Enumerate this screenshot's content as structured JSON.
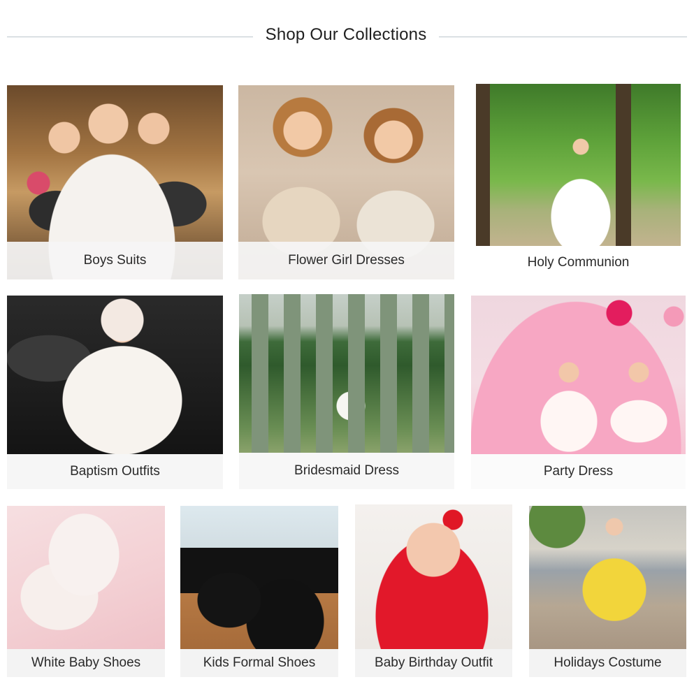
{
  "header": {
    "title": "Shop Our Collections"
  },
  "collections": [
    {
      "label": "Boys Suits",
      "icon": "photo-boys-suits"
    },
    {
      "label": "Flower Girl Dresses",
      "icon": "photo-flower-girl-dresses"
    },
    {
      "label": "Holy Communion",
      "icon": "photo-holy-communion"
    },
    {
      "label": "Baptism Outfits",
      "icon": "photo-baptism-outfits"
    },
    {
      "label": "Bridesmaid Dress",
      "icon": "photo-bridesmaid-dress"
    },
    {
      "label": "Party Dress",
      "icon": "photo-party-dress"
    },
    {
      "label": "White Baby Shoes",
      "icon": "photo-white-baby-shoes"
    },
    {
      "label": "Kids Formal Shoes",
      "icon": "photo-kids-formal-shoes"
    },
    {
      "label": "Baby Birthday Outfit",
      "icon": "photo-baby-birthday-outfit"
    },
    {
      "label": "Holidays Costume",
      "icon": "photo-holidays-costume"
    }
  ],
  "colors": {
    "background": "#ffffff",
    "title_text": "#1f1f1f",
    "label_text": "#2a2a2a",
    "label_band": "#f5f5f5",
    "rule": "#cfd5da"
  }
}
